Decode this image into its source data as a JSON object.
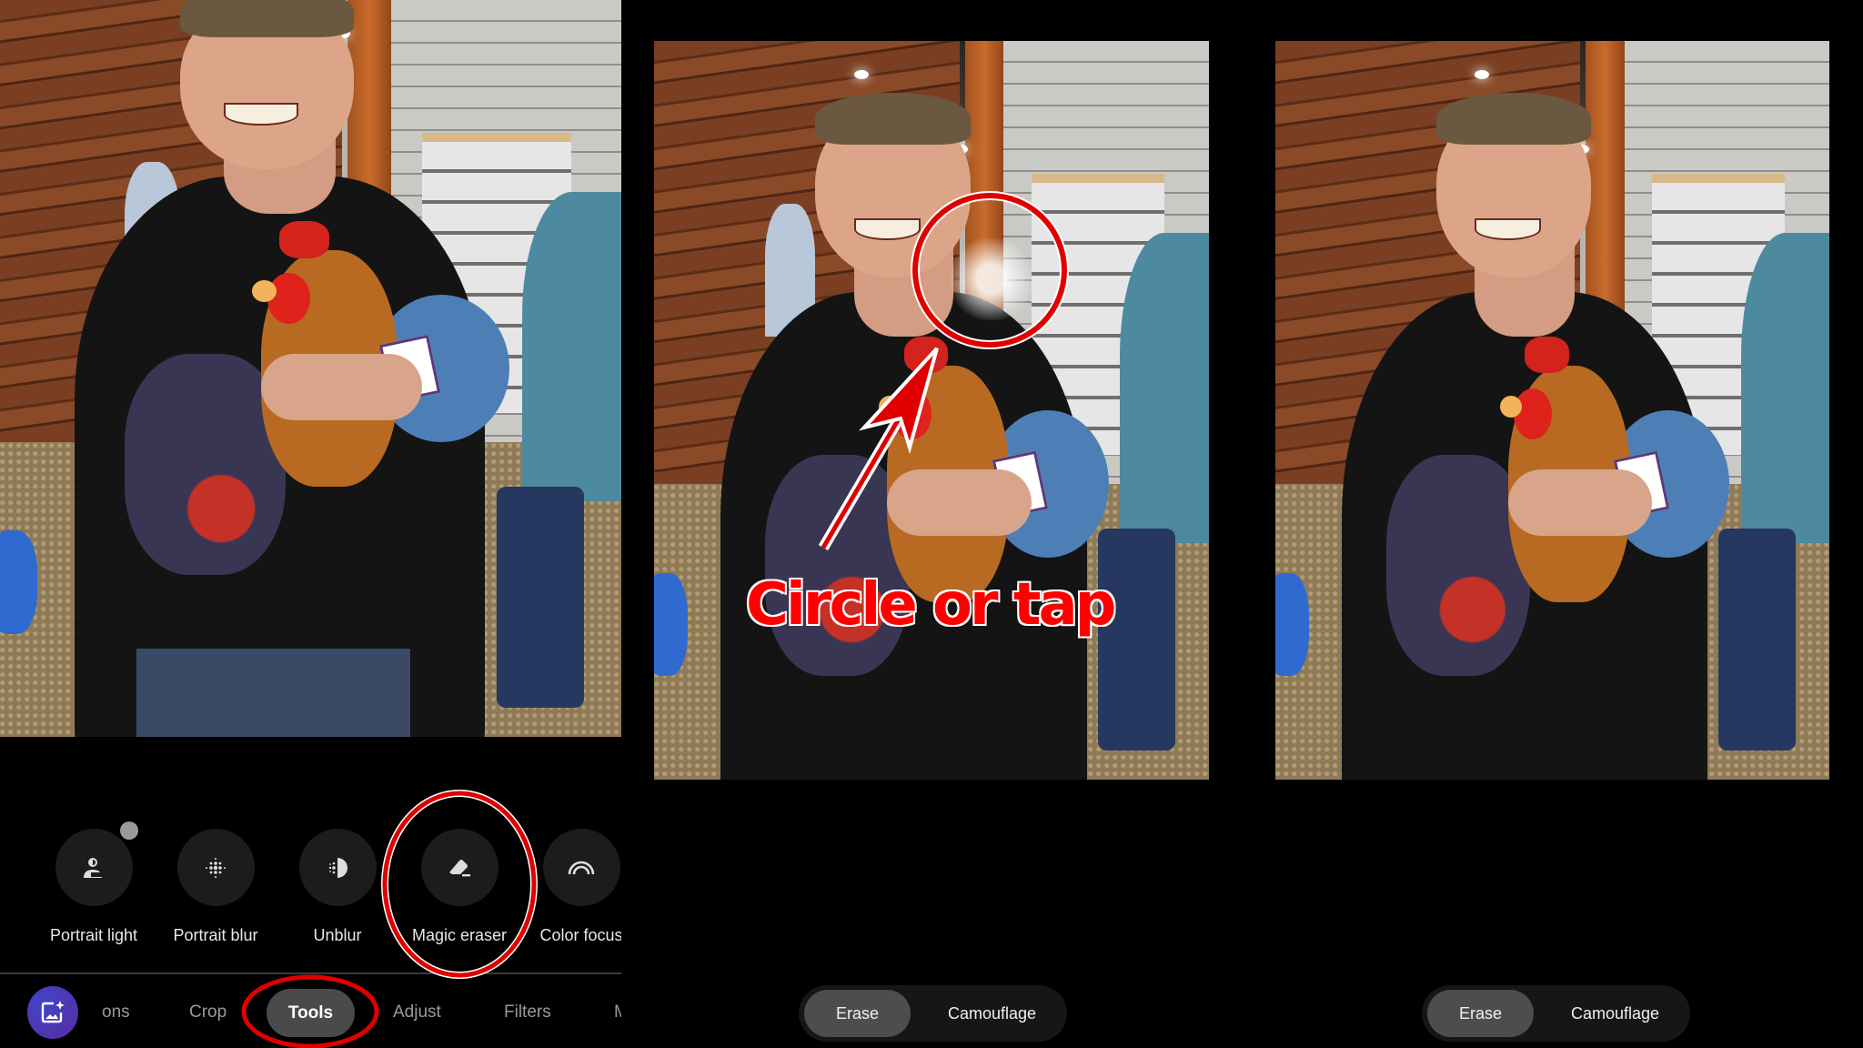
{
  "panels": [
    {
      "id": "tools-view",
      "tools": [
        {
          "label": "Portrait light",
          "icon": "portrait-light-icon",
          "has_dot": true
        },
        {
          "label": "Portrait blur",
          "icon": "portrait-blur-icon"
        },
        {
          "label": "Unblur",
          "icon": "unblur-icon"
        },
        {
          "label": "Magic eraser",
          "icon": "eraser-icon"
        },
        {
          "label": "Color focus",
          "icon": "color-focus-icon"
        }
      ],
      "nav": {
        "items": [
          "ons",
          "Crop",
          "Tools",
          "Adjust",
          "Filters",
          "M"
        ],
        "active": "Tools",
        "assistant_icon": "magic-editor-icon"
      }
    },
    {
      "id": "magic-eraser-select",
      "segmented": {
        "options": [
          "Erase",
          "Camouflage"
        ],
        "active": "Erase"
      },
      "annotation": "Circle or tap"
    },
    {
      "id": "magic-eraser-result",
      "segmented": {
        "options": [
          "Erase",
          "Camouflage"
        ],
        "active": "Erase"
      }
    }
  ],
  "colors": {
    "annotation_red": "#ff0000",
    "pill_active": "#4d4d4d",
    "tool_circle": "#1c1c1c",
    "nav_inactive": "#9a9a9a",
    "assistant_gradient": [
      "#3f46c8",
      "#5a2aa0"
    ]
  }
}
